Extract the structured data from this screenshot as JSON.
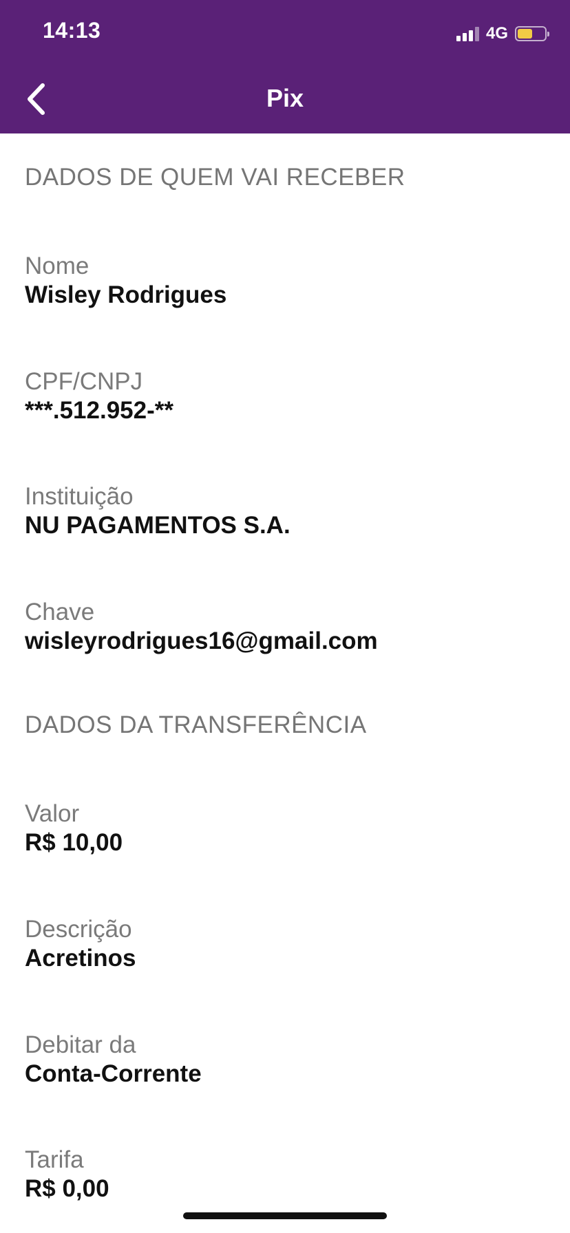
{
  "status_bar": {
    "time": "14:13",
    "network": "4G",
    "battery_level": 0.55,
    "battery_color": "#f2cc45"
  },
  "header": {
    "title": "Pix",
    "back_icon": "chevron-left-icon",
    "background": "#5a2177"
  },
  "recipient": {
    "section_title": "DADOS DE QUEM VAI RECEBER",
    "fields": [
      {
        "label": "Nome",
        "value": "Wisley Rodrigues"
      },
      {
        "label": "CPF/CNPJ",
        "value": "***.512.952-**"
      },
      {
        "label": "Instituição",
        "value": "NU PAGAMENTOS S.A."
      },
      {
        "label": "Chave",
        "value": "wisleyrodrigues16@gmail.com"
      }
    ]
  },
  "transfer": {
    "section_title": "DADOS DA TRANSFERÊNCIA",
    "fields": [
      {
        "label": "Valor",
        "value": "R$ 10,00"
      },
      {
        "label": "Descrição",
        "value": "Acretinos"
      },
      {
        "label": "Debitar da",
        "value": "Conta-Corrente"
      },
      {
        "label": "Tarifa",
        "value": "R$ 0,00"
      }
    ]
  }
}
